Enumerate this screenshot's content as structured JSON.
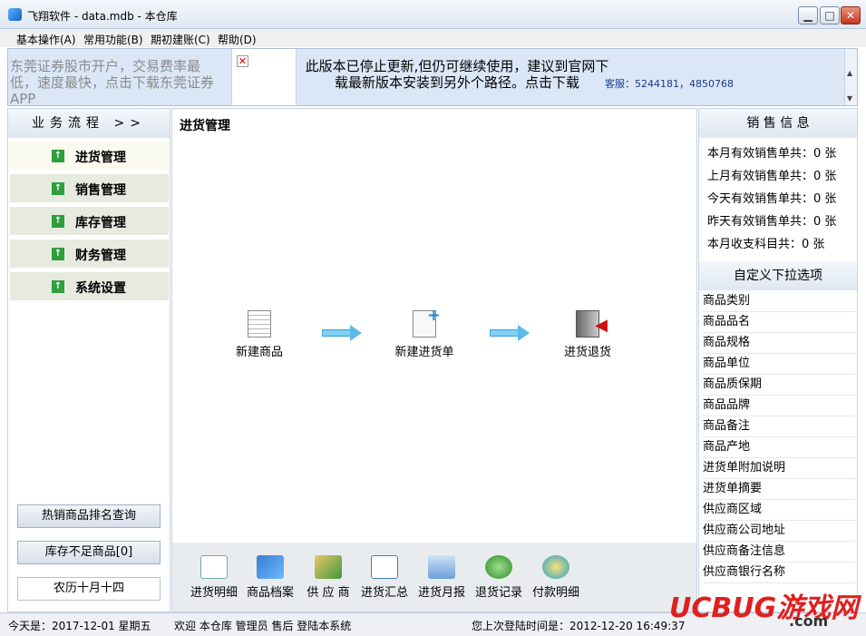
{
  "window": {
    "title": "飞翔软件 - data.mdb - 本仓库"
  },
  "menu": [
    "基本操作(A)",
    "常用功能(B)",
    "期初建账(C)",
    "帮助(D)"
  ],
  "banner": {
    "ad_text": "东莞证券股市开户，交易费率最低，速度最快，点击下载东莞证券APP",
    "notice": "此版本已停止更新,但仍可继续使用，建议到官网下载最新版本安装到另外个路径。点击下载",
    "service": "客服：5244181，4850768"
  },
  "left": {
    "header": "业务流程 >>",
    "nav": [
      "进货管理",
      "销售管理",
      "库存管理",
      "财务管理",
      "系统设置"
    ],
    "buttons": {
      "hot": "热销商品排名查询",
      "low_stock": "库存不足商品[0]",
      "lunar": "农历十月十四"
    }
  },
  "center": {
    "title": "进货管理",
    "flow": [
      "新建商品",
      "新建进货单",
      "进货退货"
    ],
    "tools": [
      "进货明细",
      "商品档案",
      "供 应 商",
      "进货汇总",
      "进货月报",
      "退货记录",
      "付款明细"
    ]
  },
  "right": {
    "sales_header": "销 售 信 息",
    "sales": [
      "本月有效销售单共：0 张",
      "上月有效销售单共：0 张",
      "今天有效销售单共：0 张",
      "昨天有效销售单共：0 张",
      "本月收支科目共：0 张"
    ],
    "options_header": "自定义下拉选项",
    "options": [
      "商品类别",
      "商品品名",
      "商品规格",
      "商品单位",
      "商品质保期",
      "商品品牌",
      "商品备注",
      "商品产地",
      "进货单附加说明",
      "进货单摘要",
      "供应商区域",
      "供应商公司地址",
      "供应商备注信息",
      "供应商银行名称"
    ]
  },
  "status": {
    "today": "今天是：2017-12-01  星期五",
    "welcome": "欢迎 本仓库 管理员 售后 登陆本系统",
    "last_login": "您上次登陆时间是：2012-12-20 16:49:37"
  },
  "watermark": {
    "brand": "UCBUG游戏网",
    "domain": ".com"
  },
  "colors": {
    "nav_bg": "#e6eadf",
    "nav_active": "#fbfaf1",
    "banner_bg": "#dbe7f7",
    "arrow": "#7fd0f5"
  }
}
